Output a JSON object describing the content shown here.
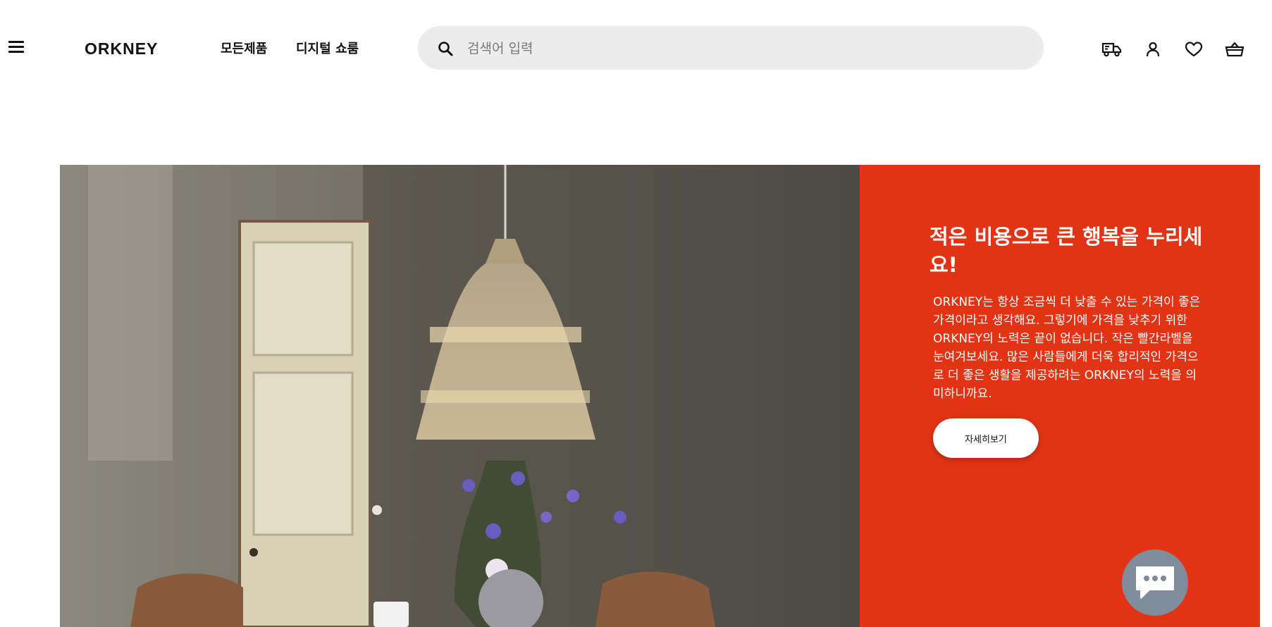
{
  "header": {
    "logo": "ORKNEY",
    "nav": [
      {
        "label": "모든제품"
      },
      {
        "label": "디지털 쇼룸"
      }
    ],
    "search": {
      "placeholder": "검색어 입력",
      "value": ""
    },
    "icons": [
      "menu-icon",
      "search-icon",
      "delivery-truck-icon",
      "user-icon",
      "heart-icon",
      "basket-icon"
    ]
  },
  "hero": {
    "title": "적은 비용으로 큰 행복을 누리세요!",
    "body": "ORKNEY는 항상 조금씩 더 낮출 수 있는 가격이 좋은 가격이라고 생각해요. 그렇기에 가격을 낮추기 위한 ORKNEY의 노력은 끝이 없습니다. 작은 빨간라벨을 눈여겨보세요. 많은 사람들에게 더욱 합리적인 가격으로 더 좋은 생활을 제공하려는 ORKNEY의 노력을 의미하니까요.",
    "cta": "자세히보기",
    "image": "dining-room-rattan-pendant-lamp"
  },
  "chat": {
    "icon": "chat-icon"
  },
  "colors": {
    "accent": "#e23414",
    "search_bg": "#ececec",
    "chat_bg": "#7f8c9a",
    "text": "#111111"
  }
}
